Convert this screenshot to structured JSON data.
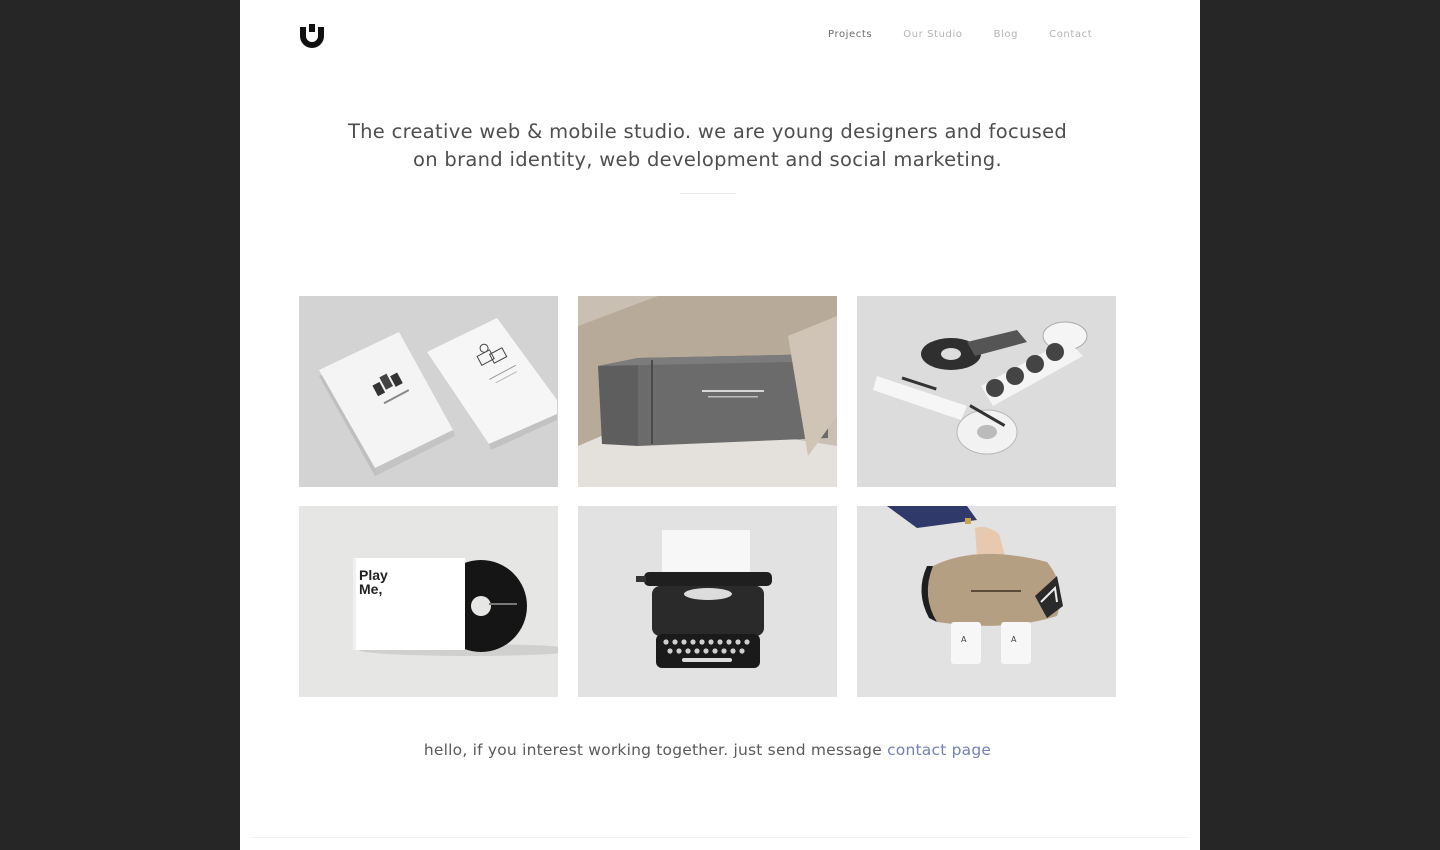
{
  "brand": {
    "logo_icon": "u-magnet-logo-icon"
  },
  "nav": {
    "items": [
      {
        "label": "Projects",
        "active": true
      },
      {
        "label": "Our Studio",
        "active": false
      },
      {
        "label": "Blog",
        "active": false
      },
      {
        "label": "Contact",
        "active": false
      }
    ]
  },
  "hero": {
    "line1": "The creative web & mobile studio. we are young designers and focused",
    "line2": "on brand identity, web development and social marketing."
  },
  "projects": {
    "tiles": [
      {
        "icon": "business-cards-image"
      },
      {
        "icon": "gray-box-packaging-image"
      },
      {
        "icon": "sticker-tape-rolls-image"
      },
      {
        "icon": "cd-sleeve-image",
        "sleeve_text": "Play\nMe,"
      },
      {
        "icon": "typewriter-image"
      },
      {
        "icon": "cup-carrier-image"
      }
    ]
  },
  "footer": {
    "message": "hello, if you interest working together. just send message ",
    "link_label": "contact page"
  },
  "colors": {
    "frame": "#262626",
    "page": "#ffffff",
    "link": "#7480b6",
    "nav_active": "#6a6a6a",
    "nav_inactive": "#b4b4b4"
  }
}
